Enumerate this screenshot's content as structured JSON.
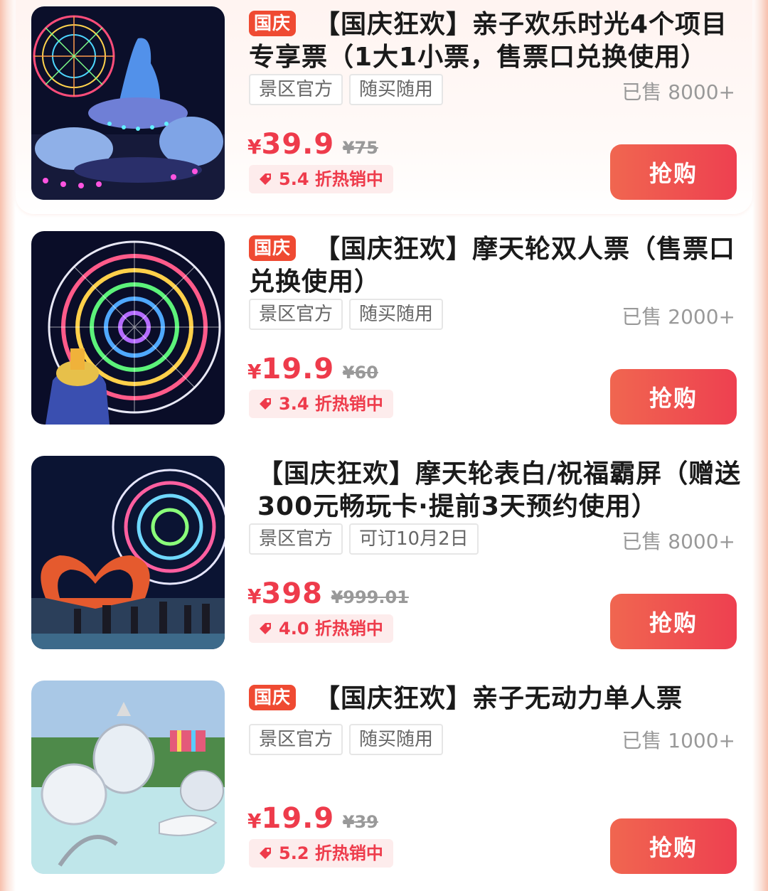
{
  "colors": {
    "accent": "#ee3b4b",
    "badge": "#ef4a32",
    "buy_button": "#ee4050"
  },
  "products": [
    {
      "badge": "国庆",
      "title": "【国庆狂欢】亲子欢乐时光4个项目专享票（1大1小票，售票口兑换使用）",
      "tags": [
        "景区官方",
        "随买随用"
      ],
      "sold": "已售 8000+",
      "currency": "¥",
      "price": "39.9",
      "original_price": "¥75",
      "discount": "5.4 折热销中",
      "buy_label": "抢购",
      "image": "illuminated-carousel-ride"
    },
    {
      "badge": "国庆",
      "title": "【国庆狂欢】摩天轮双人票（售票口兑换使用）",
      "tags": [
        "景区官方",
        "随买随用"
      ],
      "sold": "已售 2000+",
      "currency": "¥",
      "price": "19.9",
      "original_price": "¥60",
      "discount": "3.4 折热销中",
      "buy_label": "抢购",
      "image": "ferris-wheel-night"
    },
    {
      "title": "【国庆狂欢】摩天轮表白/祝福霸屏（赠送300元畅玩卡·提前3天预约使用）",
      "tags": [
        "景区官方",
        "可订10月2日"
      ],
      "sold": "已售 8000+",
      "currency": "¥",
      "price": "398",
      "original_price": "¥999.01",
      "discount": "4.0 折热销中",
      "buy_label": "抢购",
      "image": "ferris-wheel-heart-hands"
    },
    {
      "badge": "国庆",
      "title": "【国庆狂欢】亲子无动力单人票",
      "tags": [
        "景区官方",
        "随买随用"
      ],
      "sold": "已售 1000+",
      "currency": "¥",
      "price": "19.9",
      "original_price": "¥39",
      "discount": "5.2 折热销中",
      "buy_label": "抢购",
      "image": "kids-playground-rendering"
    }
  ]
}
